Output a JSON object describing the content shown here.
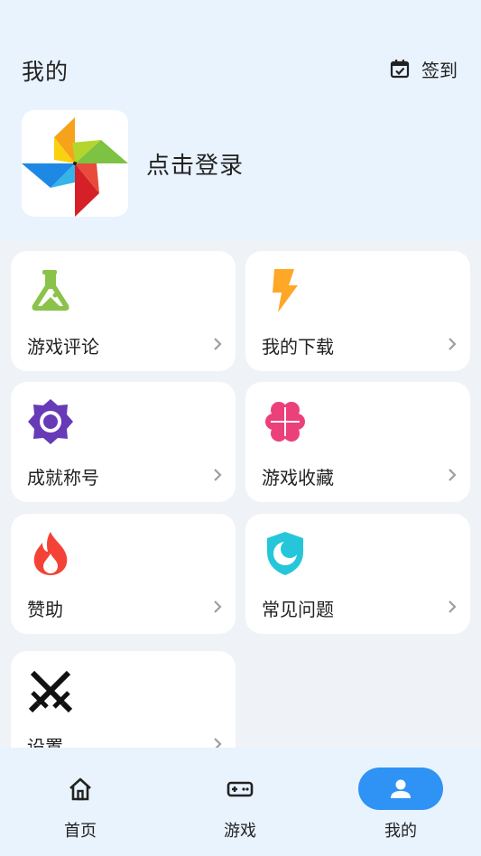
{
  "header": {
    "title": "我的",
    "checkin_label": "签到",
    "login_label": "点击登录"
  },
  "cards": [
    {
      "label": "游戏评论",
      "icon": "flask-icon",
      "color": "#8bc34a"
    },
    {
      "label": "我的下载",
      "icon": "lightning-icon",
      "color": "#ffa726"
    },
    {
      "label": "成就称号",
      "icon": "sun-badge-icon",
      "color": "#673ab7"
    },
    {
      "label": "游戏收藏",
      "icon": "clover-heart-icon",
      "color": "#ec407a"
    },
    {
      "label": "赞助",
      "icon": "fire-icon",
      "color": "#f44336"
    },
    {
      "label": "常见问题",
      "icon": "shield-moon-icon",
      "color": "#26c6da"
    },
    {
      "label": "设置",
      "icon": "crossed-swords-icon",
      "color": "#111111"
    }
  ],
  "nav": [
    {
      "label": "首页",
      "icon": "home-icon",
      "active": false
    },
    {
      "label": "游戏",
      "icon": "gamepad-icon",
      "active": false
    },
    {
      "label": "我的",
      "icon": "person-icon",
      "active": true
    }
  ],
  "colors": {
    "accent": "#2e93f5",
    "header_bg": "#e9f3fe",
    "page_bg": "#eff2f6"
  }
}
